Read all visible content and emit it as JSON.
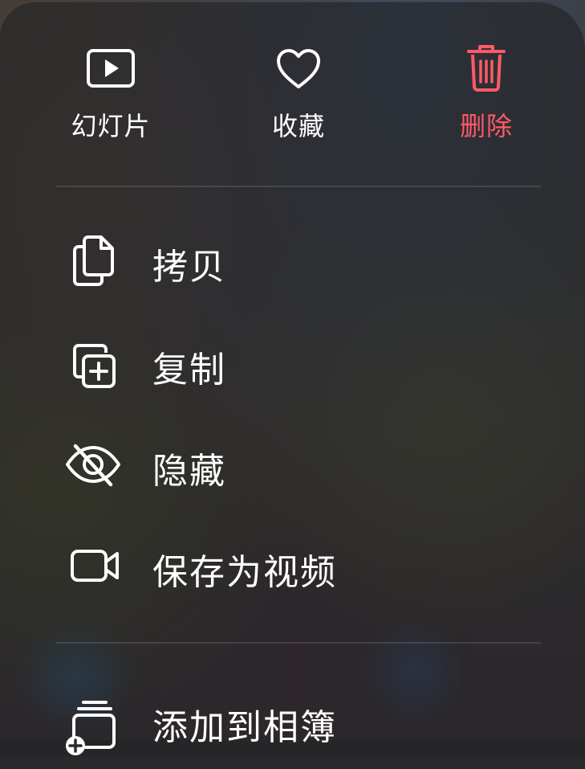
{
  "top_actions": [
    {
      "label": "幻灯片",
      "icon": "slideshow-play-icon"
    },
    {
      "label": "收藏",
      "icon": "heart-icon"
    },
    {
      "label": "删除",
      "icon": "trash-icon"
    }
  ],
  "menu_items": [
    {
      "label": "拷贝",
      "icon": "copy-documents-icon"
    },
    {
      "label": "复制",
      "icon": "duplicate-plus-icon"
    },
    {
      "label": "隐藏",
      "icon": "eye-slash-icon"
    },
    {
      "label": "保存为视频",
      "icon": "video-camera-icon"
    },
    {
      "label": "添加到相簿",
      "icon": "add-to-album-icon"
    }
  ],
  "colors": {
    "text": "#ffffff",
    "destructive": "#ff5a66",
    "separator": "rgba(255,255,255,0.12)"
  }
}
